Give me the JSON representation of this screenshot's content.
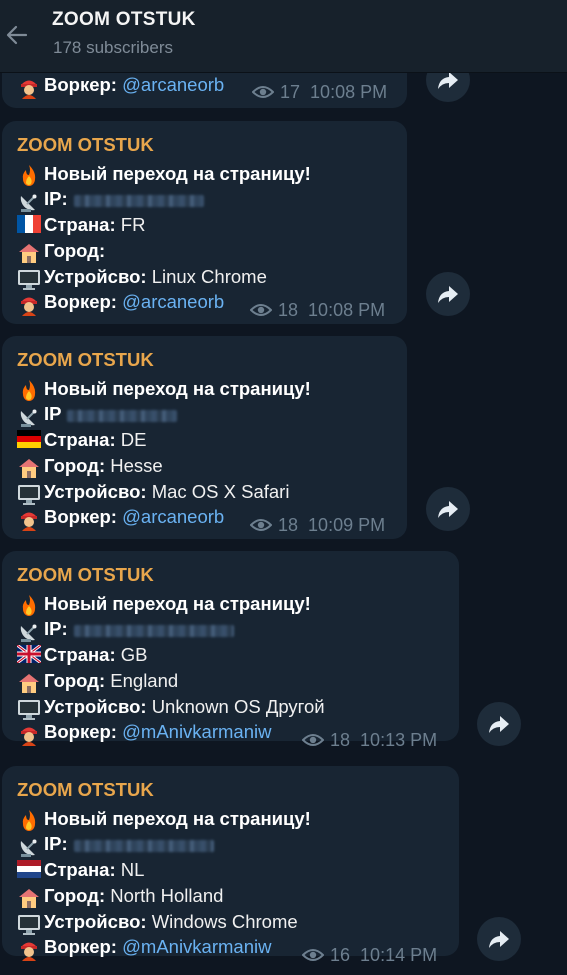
{
  "header": {
    "title": "ZOOM OTSTUK",
    "subtitle": "178 subscribers"
  },
  "labels": {
    "ip": "IP:",
    "country": "Страна:",
    "city": "Город:",
    "device": "Устройсво:",
    "worker": "Воркер:"
  },
  "partial_message": {
    "worker": "@arcaneorb",
    "views": "17",
    "time": "10:08 PM"
  },
  "messages": [
    {
      "sender": "ZOOM OTSTUK",
      "headline": "Новый переход на страницу!",
      "ip_label": "IP:",
      "country": "FR",
      "city": "",
      "device": "Linux Chrome",
      "worker": "@arcaneorb",
      "views": "18",
      "time": "10:08 PM"
    },
    {
      "sender": "ZOOM OTSTUK",
      "headline": "Новый переход на страницу!",
      "ip_label": "IP",
      "country": "DE",
      "city": "Hesse",
      "device": "Mac OS X Safari",
      "worker": "@arcaneorb",
      "views": "18",
      "time": "10:09 PM"
    },
    {
      "sender": "ZOOM OTSTUK",
      "headline": "Новый переход на страницу!",
      "ip_label": "IP:",
      "country": "GB",
      "city": "England",
      "device": "Unknown OS Другой",
      "worker": "@mAnivkarmaniw",
      "views": "18",
      "time": "10:13 PM"
    },
    {
      "sender": "ZOOM OTSTUK",
      "headline": "Новый переход на страницу!",
      "ip_label": "IP:",
      "country": "NL",
      "city": "North Holland",
      "device": "Windows Chrome",
      "worker": "@mAnivkarmaniw",
      "views": "16",
      "time": "10:14 PM"
    }
  ],
  "icons": {
    "back": "arrow-left-icon",
    "forward": "share-arrow-icon",
    "views": "eye-icon"
  },
  "colors": {
    "background": "#0e1621",
    "header": "#17212b",
    "bubble": "#182533",
    "sender": "#e8a64c",
    "link": "#6ab2f2",
    "meta": "#6d7f8f"
  }
}
